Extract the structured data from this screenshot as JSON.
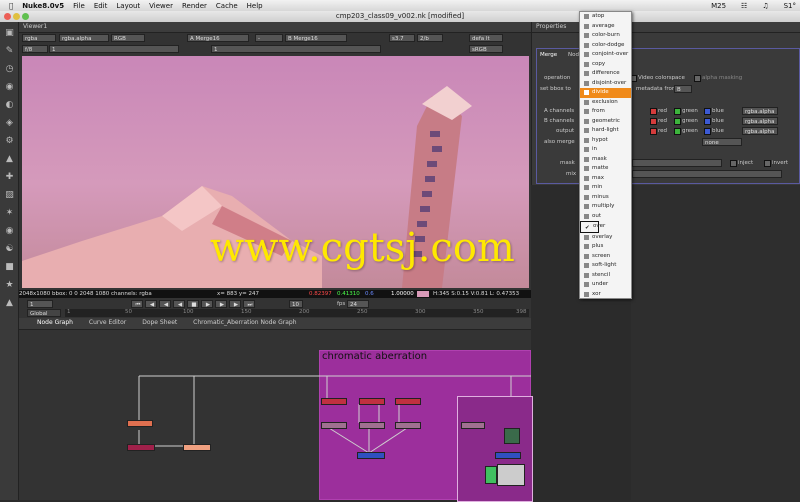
{
  "menubar": {
    "app": "Nuke8.0v5",
    "items": [
      "File",
      "Edit",
      "Layout",
      "Viewer",
      "Render",
      "Cache",
      "Help"
    ],
    "status": [
      "M25",
      "S1°"
    ]
  },
  "window": {
    "title": "cmp203_class09_v002.nk [modified]"
  },
  "viewer": {
    "tab": "Viewer1",
    "channels": "rgba",
    "alpha": "rgba.alpha",
    "colorspace": "RGB",
    "input_a": "A  Merge16",
    "input_b": "B  Merge16",
    "zoom": "s3.7",
    "size": "2/b",
    "lut": "sRGB",
    "proxy": "defa lt",
    "gain": "f/8",
    "gamma": "1",
    "y_val": "1",
    "info_left": "2048x1080  bbox: 0 0 2048 1080  channels: rgba",
    "info_xy": "x= 883 y= 247",
    "info_r": "0.82397",
    "info_g": "0.41310",
    "info_b": "0.6",
    "info_a": "1.00000",
    "info_hsv": "H:345 S:0.15 V:0.81  L: 0.47353",
    "frame": "1",
    "fps_label": "fps",
    "fps": "24",
    "playbar_frame": "10",
    "global": "Global",
    "ticks": [
      "1",
      "50",
      "100",
      "150",
      "200",
      "250",
      "300",
      "350",
      "398"
    ]
  },
  "properties": {
    "title": "Properties",
    "node_tab": "Merge",
    "node_tab2": "Node",
    "operation_label": "operation",
    "video_colorspace": "Video colorspace",
    "alpha_masking": "alpha masking",
    "set_bbox_label": "set bbox to",
    "metadata_label": "metadata from",
    "metadata_val": "B",
    "a_channels": "A channels",
    "b_channels": "B channels",
    "output": "output",
    "also_merge": "also merge",
    "also_merge_val": "none",
    "mask": "mask",
    "mix": "mix",
    "inject": "inject",
    "invert": "invert",
    "rgba": "rgba",
    "red": "red",
    "green": "green",
    "blue": "blue",
    "alpha_val": "rgba.alpha"
  },
  "dropdown": {
    "items": [
      "atop",
      "average",
      "color-burn",
      "color-dodge",
      "conjoint-over",
      "copy",
      "difference",
      "disjoint-over",
      "divide",
      "exclusion",
      "from",
      "geometric",
      "hard-light",
      "hypot",
      "in",
      "mask",
      "matte",
      "max",
      "min",
      "minus",
      "multiply",
      "out",
      "over",
      "overlay",
      "plus",
      "screen",
      "soft-light",
      "stencil",
      "under",
      "xor"
    ],
    "selected": "divide",
    "checked": "over"
  },
  "nodegraph": {
    "tabs": [
      "Node Graph",
      "Curve Editor",
      "Dope Sheet",
      "Chromatic_Aberration Node Graph"
    ],
    "backdrop_label": "chromatic aberration"
  },
  "watermark": "www.cgtsj.com",
  "colors": {
    "accent": "#f08a1a",
    "backdrop": "#9c2f9c",
    "watermark": "#ffe800"
  }
}
